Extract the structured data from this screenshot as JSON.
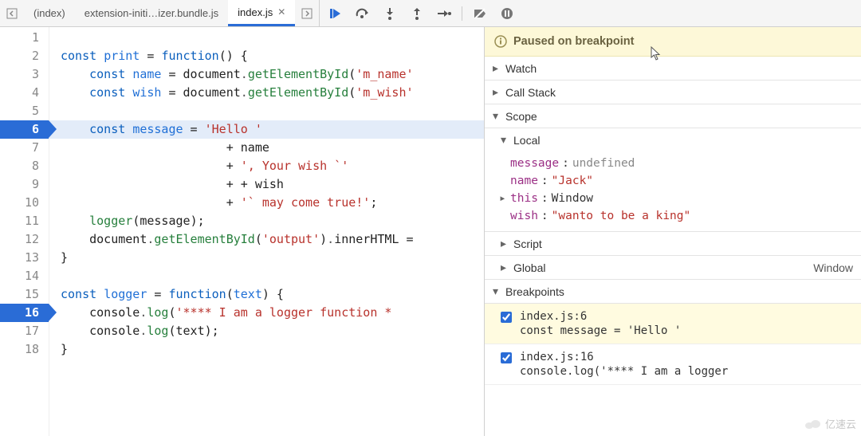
{
  "tabs": [
    {
      "label": "(index)",
      "active": false
    },
    {
      "label": "extension-initi…izer.bundle.js",
      "active": false
    },
    {
      "label": "index.js",
      "active": true
    }
  ],
  "code": {
    "lines": [
      {
        "n": 1,
        "bp": false,
        "exec": false,
        "tokens": []
      },
      {
        "n": 2,
        "bp": false,
        "exec": false,
        "tokens": [
          [
            "kw",
            "const "
          ],
          [
            "id",
            "print"
          ],
          [
            "pl",
            " = "
          ],
          [
            "kw",
            "function"
          ],
          [
            "pl",
            "() {"
          ]
        ]
      },
      {
        "n": 3,
        "bp": false,
        "exec": false,
        "tokens": [
          [
            "pl",
            "    "
          ],
          [
            "kw",
            "const "
          ],
          [
            "id",
            "name"
          ],
          [
            "pl",
            " = "
          ],
          [
            "pl",
            "document"
          ],
          [
            "dot",
            "."
          ],
          [
            "mth",
            "getElementById"
          ],
          [
            "pl",
            "("
          ],
          [
            "str",
            "'m_name'"
          ]
        ]
      },
      {
        "n": 4,
        "bp": false,
        "exec": false,
        "tokens": [
          [
            "pl",
            "    "
          ],
          [
            "kw",
            "const "
          ],
          [
            "id",
            "wish"
          ],
          [
            "pl",
            " = "
          ],
          [
            "pl",
            "document"
          ],
          [
            "dot",
            "."
          ],
          [
            "mth",
            "getElementById"
          ],
          [
            "pl",
            "("
          ],
          [
            "str",
            "'m_wish'"
          ]
        ]
      },
      {
        "n": 5,
        "bp": false,
        "exec": false,
        "tokens": []
      },
      {
        "n": 6,
        "bp": true,
        "exec": true,
        "tokens": [
          [
            "pl",
            "    "
          ],
          [
            "kw",
            "const "
          ],
          [
            "id",
            "message"
          ],
          [
            "pl",
            " = "
          ],
          [
            "str",
            "'Hello '"
          ]
        ]
      },
      {
        "n": 7,
        "bp": false,
        "exec": false,
        "tokens": [
          [
            "pl",
            "                       + "
          ],
          [
            "pl",
            "name"
          ]
        ]
      },
      {
        "n": 8,
        "bp": false,
        "exec": false,
        "tokens": [
          [
            "pl",
            "                       + "
          ],
          [
            "str",
            "', Your wish `'"
          ]
        ]
      },
      {
        "n": 9,
        "bp": false,
        "exec": false,
        "tokens": [
          [
            "pl",
            "                       + + "
          ],
          [
            "pl",
            "wish"
          ]
        ]
      },
      {
        "n": 10,
        "bp": false,
        "exec": false,
        "tokens": [
          [
            "pl",
            "                       + "
          ],
          [
            "str",
            "'` may come true!'"
          ],
          [
            "pl",
            ";"
          ]
        ]
      },
      {
        "n": 11,
        "bp": false,
        "exec": false,
        "tokens": [
          [
            "pl",
            "    "
          ],
          [
            "mth",
            "logger"
          ],
          [
            "pl",
            "("
          ],
          [
            "pl",
            "message"
          ],
          [
            "pl",
            ");"
          ]
        ]
      },
      {
        "n": 12,
        "bp": false,
        "exec": false,
        "tokens": [
          [
            "pl",
            "    document"
          ],
          [
            "dot",
            "."
          ],
          [
            "mth",
            "getElementById"
          ],
          [
            "pl",
            "("
          ],
          [
            "str",
            "'output'"
          ],
          [
            "pl",
            ")"
          ],
          [
            "dot",
            "."
          ],
          [
            "pl",
            "innerHTML ="
          ]
        ]
      },
      {
        "n": 13,
        "bp": false,
        "exec": false,
        "tokens": [
          [
            "pl",
            "}"
          ]
        ]
      },
      {
        "n": 14,
        "bp": false,
        "exec": false,
        "tokens": []
      },
      {
        "n": 15,
        "bp": false,
        "exec": false,
        "tokens": [
          [
            "kw",
            "const "
          ],
          [
            "id",
            "logger"
          ],
          [
            "pl",
            " = "
          ],
          [
            "kw",
            "function"
          ],
          [
            "pl",
            "("
          ],
          [
            "id",
            "text"
          ],
          [
            "pl",
            ") {"
          ]
        ]
      },
      {
        "n": 16,
        "bp": true,
        "exec": false,
        "tokens": [
          [
            "pl",
            "    "
          ],
          [
            "pl",
            "console"
          ],
          [
            "dot",
            "."
          ],
          [
            "mth",
            "log"
          ],
          [
            "pl",
            "("
          ],
          [
            "str",
            "'**** I am a logger function *"
          ]
        ]
      },
      {
        "n": 17,
        "bp": false,
        "exec": false,
        "tokens": [
          [
            "pl",
            "    console"
          ],
          [
            "dot",
            "."
          ],
          [
            "mth",
            "log"
          ],
          [
            "pl",
            "("
          ],
          [
            "pl",
            "text"
          ],
          [
            "pl",
            ");"
          ]
        ]
      },
      {
        "n": 18,
        "bp": false,
        "exec": false,
        "tokens": [
          [
            "pl",
            "}"
          ]
        ]
      }
    ]
  },
  "banner": "Paused on breakpoint",
  "sections": {
    "watch": "Watch",
    "callstack": "Call Stack",
    "scope": "Scope",
    "local": "Local",
    "script": "Script",
    "global": "Global",
    "global_value": "Window",
    "breakpoints": "Breakpoints"
  },
  "scope_local": [
    {
      "name": "message",
      "sep": ": ",
      "value": "undefined",
      "vclass": "val-undef",
      "expandable": false
    },
    {
      "name": "name",
      "sep": ": ",
      "value": "\"Jack\"",
      "vclass": "val-str",
      "expandable": false
    },
    {
      "name": "this",
      "sep": ": ",
      "value": "Window",
      "vclass": "val-win",
      "expandable": true
    },
    {
      "name": "wish",
      "sep": ": ",
      "value": "\"wanto to be a king\"",
      "vclass": "val-str",
      "expandable": false
    }
  ],
  "breakpoints": [
    {
      "loc": "index.js:6",
      "src": "const message = 'Hello '",
      "checked": true,
      "active": true
    },
    {
      "loc": "index.js:16",
      "src": "console.log('**** I am a logger",
      "checked": true,
      "active": false
    }
  ],
  "watermark": "亿速云"
}
